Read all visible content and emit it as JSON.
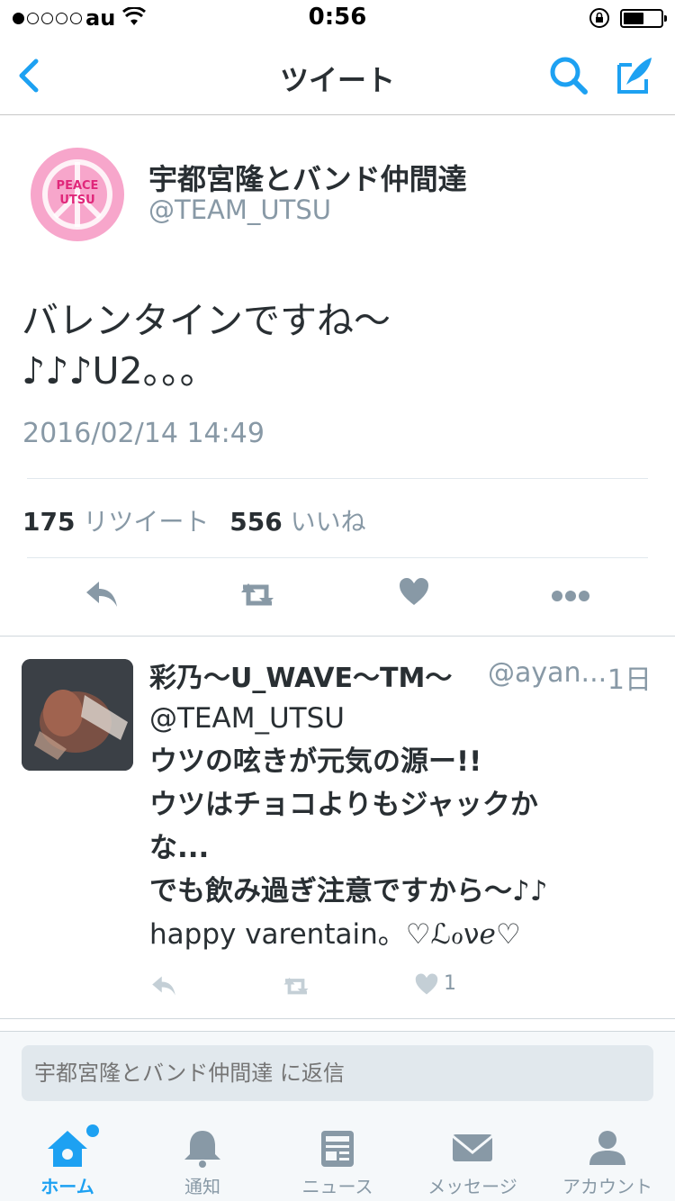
{
  "status_bar": {
    "carrier": "au",
    "time": "0:56"
  },
  "nav": {
    "title": "ツイート",
    "icons": [
      "back-chevron-icon",
      "search-icon",
      "compose-icon"
    ]
  },
  "tweet": {
    "author_name": "宇都宮隆とバンド仲間達",
    "author_handle": "@TEAM_UTSU",
    "text_lines": [
      "バレンタインですね〜",
      "♪♪♪U2。。。"
    ],
    "timestamp": "2016/02/14 14:49",
    "retweet_count": "175",
    "retweet_label": "リツイート",
    "like_count": "556",
    "like_label": "いいね"
  },
  "reply": {
    "author_name": "彩乃〜U_WAVE〜TM〜",
    "author_handle": "@ayan...",
    "time": "1日",
    "text_lines": [
      "@TEAM_UTSU",
      "ウツの呟きが元気の源ー!!",
      "ウツはチョコよりもジャックか",
      "な...",
      "でも飲み過ぎ注意ですから〜♪♪",
      "happy varentain。♡ℒℴνℯ♡"
    ],
    "like_count": "1"
  },
  "reply_bar": {
    "placeholder": "宇都宮隆とバンド仲間達 に返信"
  },
  "tabbar": {
    "tabs": [
      {
        "label": "ホーム",
        "icon": "home-icon",
        "active": true
      },
      {
        "label": "通知",
        "icon": "bell-icon",
        "active": false
      },
      {
        "label": "ニュース",
        "icon": "news-icon",
        "active": false
      },
      {
        "label": "メッセージ",
        "icon": "envelope-icon",
        "active": false
      },
      {
        "label": "アカウント",
        "icon": "person-icon",
        "active": false
      }
    ]
  },
  "colors": {
    "accent": "#1da1f2",
    "text": "#292f33",
    "secondary": "#8899a6",
    "icon_gray": "#8899a6",
    "avatar_pink": "#f7a6cb"
  }
}
